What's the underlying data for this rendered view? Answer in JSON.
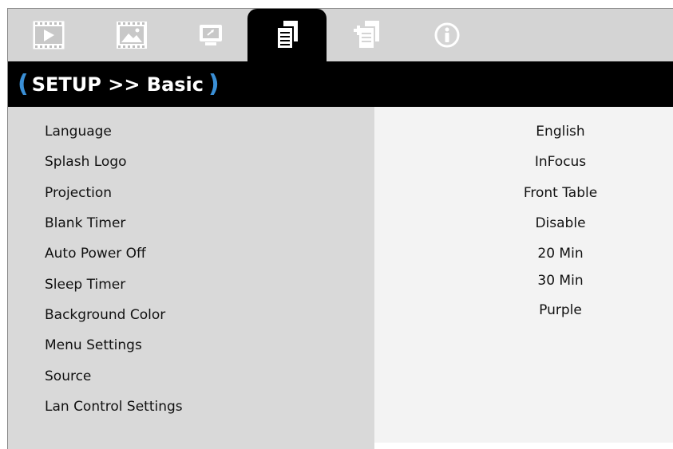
{
  "tabs": [
    {
      "name": "image",
      "icon": "film-play-icon",
      "active": false
    },
    {
      "name": "display",
      "icon": "picture-frame-icon",
      "active": false
    },
    {
      "name": "screen",
      "icon": "monitor-icon",
      "active": false
    },
    {
      "name": "setup-basic",
      "icon": "documents-icon",
      "active": true
    },
    {
      "name": "setup-advanced",
      "icon": "add-document-icon",
      "active": false
    },
    {
      "name": "information",
      "icon": "info-circle-icon",
      "active": false
    }
  ],
  "header": {
    "open_paren": "(",
    "title": "SETUP >> Basic",
    "close_paren": ")"
  },
  "menu": {
    "items": [
      {
        "label": "Language",
        "value": "English"
      },
      {
        "label": "Splash Logo",
        "value": "InFocus"
      },
      {
        "label": "Projection",
        "value": "Front Table"
      },
      {
        "label": "Blank Timer",
        "value": "Disable"
      },
      {
        "label": "Auto Power Off",
        "value": "20 Min"
      },
      {
        "label": "Sleep Timer",
        "value": "30 Min"
      },
      {
        "label": "Background Color",
        "value": "Purple"
      },
      {
        "label": "Menu Settings",
        "value": ""
      },
      {
        "label": "Source",
        "value": ""
      },
      {
        "label": "Lan Control Settings",
        "value": ""
      }
    ]
  },
  "colors": {
    "accent": "#3a8fd6",
    "header_bg": "#000000",
    "label_column_bg": "#d9d9d9",
    "value_column_bg": "#f3f3f3",
    "tabbar_bg": "#d4d4d4"
  }
}
